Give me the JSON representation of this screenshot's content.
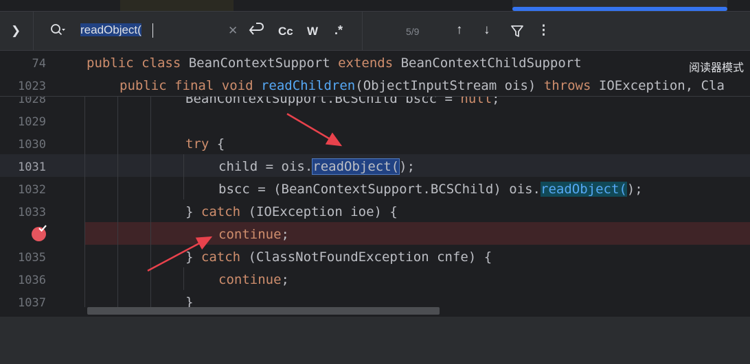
{
  "search": {
    "query": "readObject(",
    "match_count": "5/9",
    "case_label": "Cc",
    "words_label": "W",
    "regex_label": ".*"
  },
  "icons": {
    "expand": "chevron-right-icon",
    "search": "search-history-icon",
    "clear": "clear-icon",
    "newline": "new-line-icon",
    "prev": "arrow-up-icon",
    "next": "arrow-down-icon",
    "filter": "filter-icon",
    "more": "more-vertical-icon"
  },
  "sticky": {
    "line1_num": "74",
    "line1": {
      "a": "public",
      "b": " ",
      "c": "class",
      "d": " BeanContextSupport ",
      "e": "extends",
      "f": " BeanContextChildSupport"
    },
    "line2_num": "1023",
    "line2": {
      "a": "public",
      "b": " ",
      "c": "final",
      "d": " ",
      "e": "void",
      "f": " ",
      "g": "readChildren",
      "h": "(ObjectInputStream ois) ",
      "i": "throws",
      "j": " IOException, Cla"
    }
  },
  "reader_mode": "阅读器模式",
  "code": {
    "l1028": {
      "num": "1028",
      "text": "BeanContextSupport.BCSChild bscc = ",
      "kw": "null",
      "end": ";"
    },
    "l1029": {
      "num": "1029"
    },
    "l1030": {
      "num": "1030",
      "kw": "try",
      "text": " {"
    },
    "l1031": {
      "num": "1031",
      "a": "child = ois.",
      "match": "readObject(",
      "b": ");"
    },
    "l1032": {
      "num": "1032",
      "a": "bscc = (BeanContextSupport.BCSChild) ois.",
      "occ": "readObject(",
      "b": ");"
    },
    "l1033": {
      "num": "1033",
      "a": "} ",
      "kw": "catch",
      "b": " (IOException ioe) {"
    },
    "l1034": {
      "kw": "continue",
      "b": ";"
    },
    "l1035": {
      "num": "1035",
      "a": "} ",
      "kw": "catch",
      "b": " (ClassNotFoundException cnfe) {"
    },
    "l1036": {
      "num": "1036",
      "kw": "continue",
      "b": ";"
    },
    "l1037": {
      "num": "1037",
      "a": "}"
    }
  },
  "colors": {
    "background": "#1e1f22",
    "keyword": "#cf8e6d",
    "function": "#56a8f5",
    "breakpoint": "#e5555e",
    "annotation_arrow": "#e8424c"
  }
}
